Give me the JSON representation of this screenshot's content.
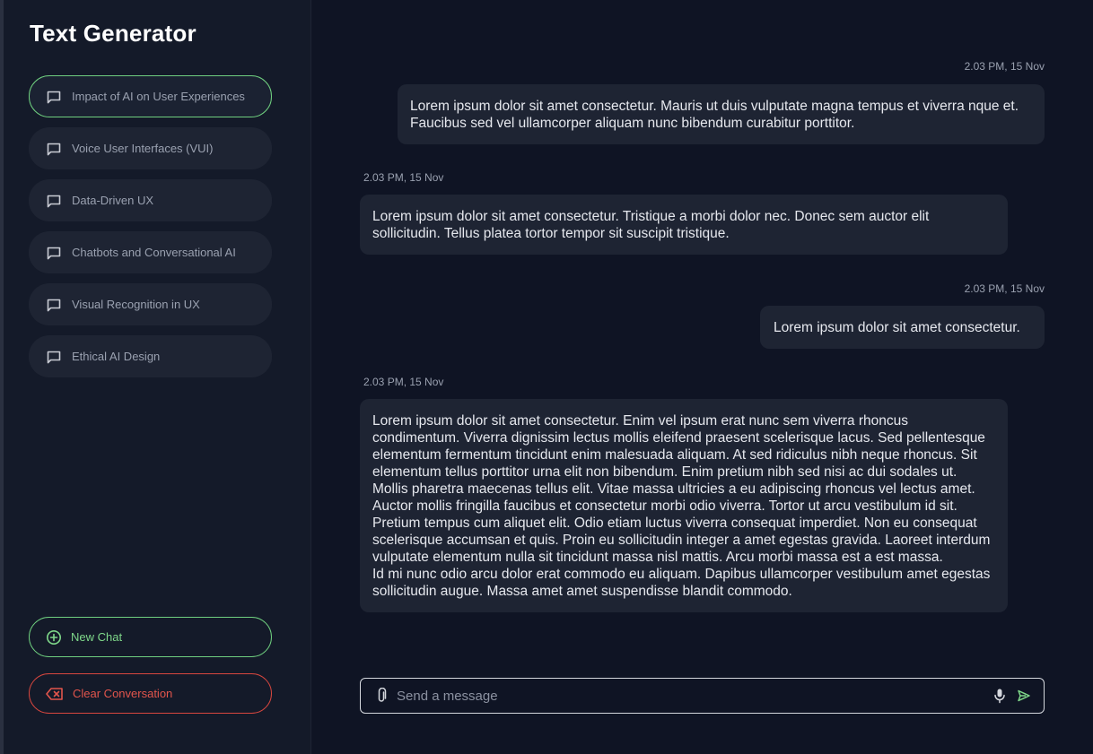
{
  "app": {
    "title": "Text Generator"
  },
  "sidebar": {
    "topics": [
      {
        "label": "Impact of AI on User Experiences",
        "active": true
      },
      {
        "label": "Voice User Interfaces (VUI)",
        "active": false
      },
      {
        "label": "Data-Driven UX",
        "active": false
      },
      {
        "label": "Chatbots and Conversational AI",
        "active": false
      },
      {
        "label": "Visual Recognition in UX",
        "active": false
      },
      {
        "label": "Ethical AI Design",
        "active": false
      }
    ],
    "new_chat_label": "New Chat",
    "clear_label": "Clear Conversation"
  },
  "messages": [
    {
      "role": "user",
      "timestamp": "2.03 PM, 15 Nov",
      "text": "Lorem ipsum dolor sit amet consectetur. Mauris ut duis vulputate magna tempus et viverra nque et. Faucibus sed vel ullamcorper aliquam nunc bibendum curabitur porttitor."
    },
    {
      "role": "assistant",
      "timestamp": "2.03 PM, 15 Nov",
      "text": "Lorem ipsum dolor sit amet consectetur. Tristique a morbi dolor nec. Donec sem auctor elit sollicitudin. Tellus platea tortor tempor sit suscipit tristique."
    },
    {
      "role": "user",
      "timestamp": "2.03 PM, 15 Nov",
      "text": "Lorem ipsum dolor sit amet consectetur."
    },
    {
      "role": "assistant",
      "timestamp": "2.03 PM, 15 Nov",
      "paragraphs": [
        "Lorem ipsum dolor sit amet consectetur. Enim vel ipsum erat nunc sem viverra rhoncus condimentum. Viverra dignissim lectus mollis eleifend praesent scelerisque lacus. Sed pellentesque elementum fermentum tincidunt enim malesuada aliquam. At sed ridiculus nibh neque rhoncus. Sit elementum tellus porttitor urna elit non bibendum. Enim pretium nibh sed nisi ac dui sodales ut. Mollis pharetra maecenas tellus elit. Vitae massa ultricies a eu adipiscing rhoncus vel lectus amet. Auctor mollis fringilla faucibus et consectetur morbi odio viverra. Tortor ut arcu vestibulum id sit.",
        "Pretium tempus cum aliquet elit. Odio etiam luctus viverra consequat imperdiet. Non eu consequat scelerisque accumsan et quis. Proin eu sollicitudin integer a amet egestas gravida. Laoreet interdum vulputate elementum nulla sit tincidunt massa nisl mattis. Arcu morbi massa est a est massa.",
        "Id mi nunc odio arcu dolor erat commodo eu aliquam. Dapibus ullamcorper vestibulum amet egestas sollicitudin augue. Massa amet amet suspendisse blandit commodo."
      ]
    }
  ],
  "composer": {
    "placeholder": "Send a message"
  },
  "colors": {
    "accent_green": "#6fcf7f",
    "danger_red": "#d9473f",
    "bubble_bg": "#1e2433",
    "page_bg": "#0f1424",
    "sidebar_bg": "#141a29"
  },
  "icons": {
    "topic": "chat-bubble-icon",
    "new_chat": "plus-circle-icon",
    "clear": "backspace-x-icon",
    "attach": "paperclip-icon",
    "mic": "microphone-icon",
    "send": "send-arrow-icon"
  }
}
